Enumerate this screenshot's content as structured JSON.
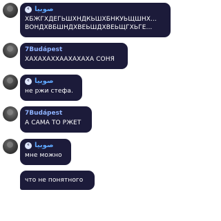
{
  "messages": [
    {
      "sender": "صوبيا",
      "lines": [
        "ХБЖГХДЕГЬШХНДКЬШХБНКУЬЩШНХ...",
        "ВОНДХВБШНДХВЕЬШДХВЕЬЩГХЬГЕ..."
      ]
    },
    {
      "sender": "7Budápest",
      "lines": [
        "ХАХАХАХХААХАХАХА СОНЯ"
      ]
    },
    {
      "sender": "صوبيا",
      "lines": [
        "не ржи стефа."
      ]
    },
    {
      "sender": "7Budápest",
      "lines": [
        "А САМА ТО РЖЕТ"
      ]
    },
    {
      "sender": "صوبيا",
      "lines": [
        "мне можно"
      ]
    },
    {
      "lines": [
        "что не понятного"
      ]
    }
  ]
}
